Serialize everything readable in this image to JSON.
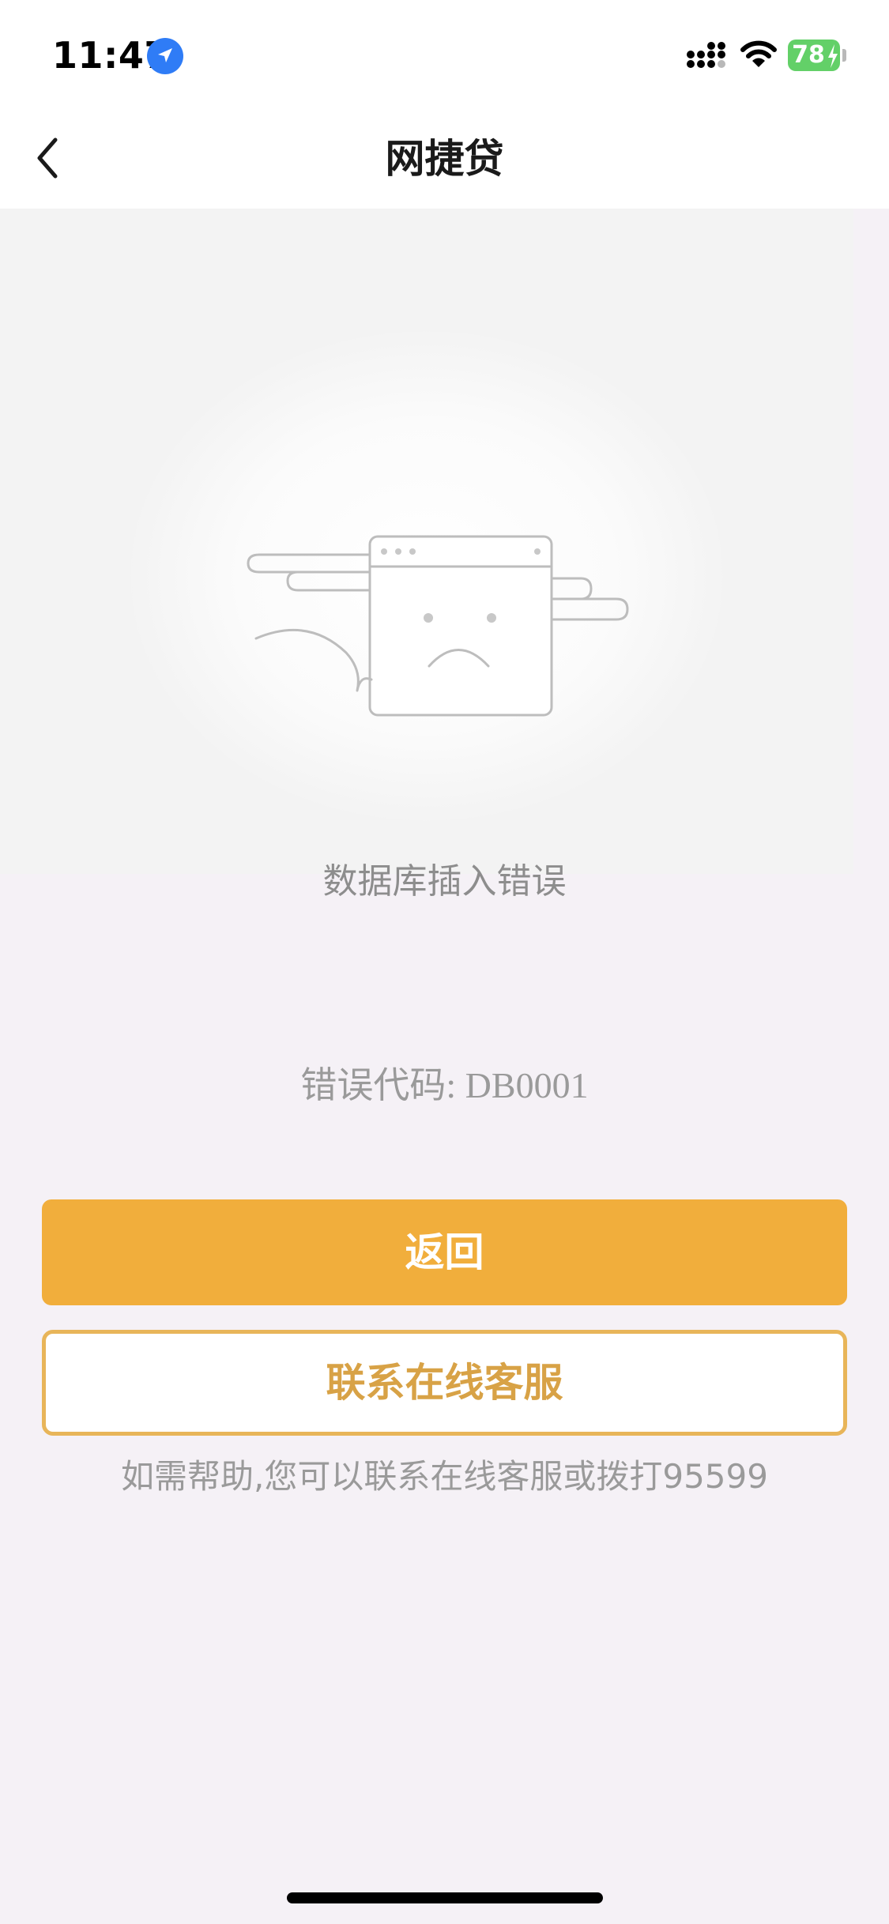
{
  "status_bar": {
    "time": "11:47",
    "battery": "78",
    "icons": [
      "location-arrow-icon",
      "signal-icon",
      "wifi-icon",
      "battery-icon"
    ]
  },
  "nav": {
    "back_icon": "chevron-left-icon",
    "title": "网捷贷"
  },
  "illustration": {
    "icon": "sad-browser-window-icon"
  },
  "error": {
    "message": "数据库插入错误",
    "code": "错误代码: DB0001"
  },
  "buttons": {
    "back_label": "返回",
    "contact_label": "联系在线客服"
  },
  "help": {
    "text": "如需帮助,您可以联系在线客服或拨打95599"
  },
  "colors": {
    "primary": "#f1ae3c",
    "outline": "#e8b559",
    "background": "#f5f1f6",
    "battery": "#63d068",
    "location": "#2f7cf6"
  }
}
